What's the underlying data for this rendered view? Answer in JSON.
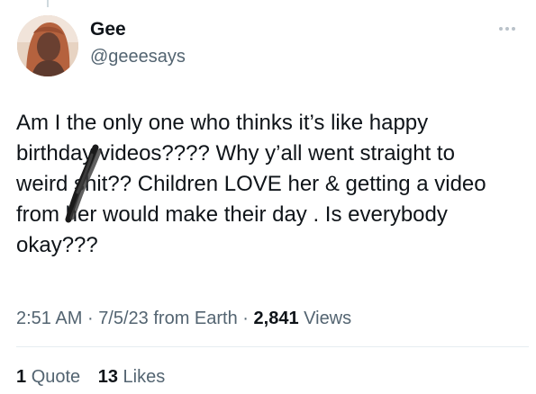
{
  "author": {
    "display_name": "Gee",
    "handle": "@geeesays"
  },
  "tweet": {
    "text": "Am I the only one who thinks it’s like happy\nbirthday videos???? Why y’all went straight to\nweird shit?? Children LOVE her & getting a video\nfrom her would make their day . Is everybody\nokay???"
  },
  "meta": {
    "time": "2:51 AM",
    "separator": "·",
    "date_source": "7/5/23 from Earth",
    "views_count": "2,841",
    "views_label": "Views"
  },
  "stats": {
    "quote_count": "1",
    "quote_label": "Quote",
    "likes_count": "13",
    "likes_label": "Likes"
  },
  "icons": {
    "more": "more-horizontal-icon"
  },
  "colors": {
    "text_primary": "#0f1419",
    "text_secondary": "#536471",
    "divider": "#e6ecf0"
  }
}
